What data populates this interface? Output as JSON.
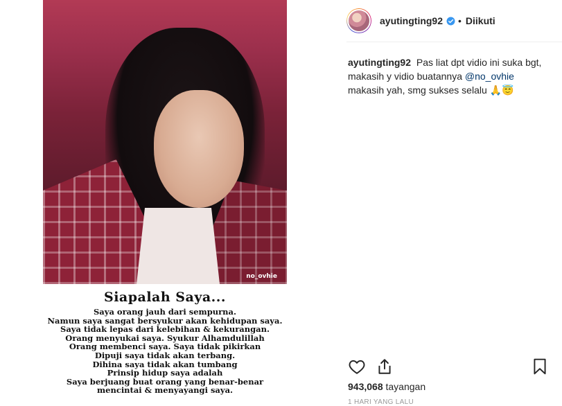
{
  "media": {
    "watermark": "no_ovhie",
    "caption_title": "Siapalah Saya...",
    "caption_lines": [
      "Saya orang jauh dari sempurna.",
      "Namun saya sangat bersyukur akan kehidupan saya.",
      "Saya tidak lepas dari kelebihan & kekurangan.",
      "Orang menyukai saya. Syukur Alhamdulillah",
      "Orang membenci saya. Saya tidak pikirkan",
      "Dipuji saya tidak akan terbang.",
      "Dihina saya tidak akan tumbang",
      "Prinsip hidup saya adalah",
      "Saya berjuang buat orang yang benar-benar",
      "mencintai & menyayangi saya."
    ]
  },
  "header": {
    "username": "ayutingting92",
    "separator": "•",
    "follow_status": "Diikuti"
  },
  "comment": {
    "username": "ayutingting92",
    "text_1": "Pas liat dpt vidio ini suka bgt, makasih y vidio buatannya",
    "mention": "@no_ovhie",
    "text_2": "makasih yah, smg sukses selalu 🙏😇"
  },
  "stats": {
    "view_count": "943,068",
    "view_label": "tayangan",
    "timestamp": "1 HARI YANG LALU"
  },
  "colors": {
    "verified_blue": "#3897f0",
    "mention": "#003569"
  }
}
